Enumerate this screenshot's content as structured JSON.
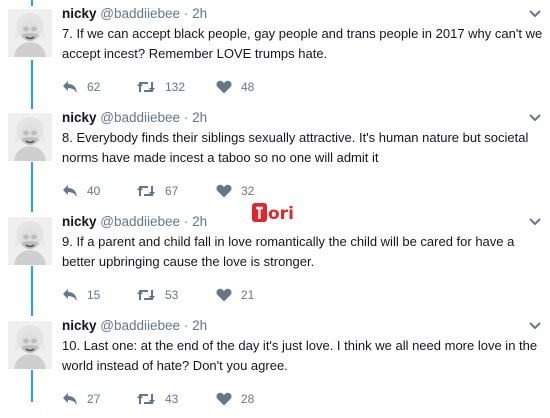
{
  "tweets": [
    {
      "name": "nicky",
      "handle": "@baddiiebee",
      "dot": "·",
      "time": "2h",
      "text": "7. If we can accept black people, gay people and trans people in 2017 why can't we accept incest? Remember LOVE trumps hate.",
      "replies": "62",
      "retweets": "132",
      "likes": "48"
    },
    {
      "name": "nicky",
      "handle": "@baddiiebee",
      "dot": "·",
      "time": "2h",
      "text": "8. Everybody finds their siblings sexually attractive. It's human nature but societal norms have made incest a taboo so no one will admit it",
      "replies": "40",
      "retweets": "67",
      "likes": "32"
    },
    {
      "name": "nicky",
      "handle": "@baddiiebee",
      "dot": "·",
      "time": "2h",
      "text": "9. If a parent and child fall in love romantically the child will be cared for have a better upbringing cause the love is stronger.",
      "replies": "15",
      "retweets": "53",
      "likes": "21"
    },
    {
      "name": "nicky",
      "handle": "@baddiiebee",
      "dot": "·",
      "time": "2h",
      "text": "10. Last one: at the end of the day it's just love. I think we all need more love in the world instead of hate? Don't you agree.",
      "replies": "27",
      "retweets": "43",
      "likes": "28"
    }
  ],
  "watermark": {
    "text": "ori",
    "color": "#e0262c"
  },
  "colors": {
    "thread": "#1da1f2",
    "muted": "#657786",
    "text": "#14171a"
  },
  "icons": [
    "reply-icon",
    "retweet-icon",
    "like-icon",
    "chevron-down-icon"
  ]
}
